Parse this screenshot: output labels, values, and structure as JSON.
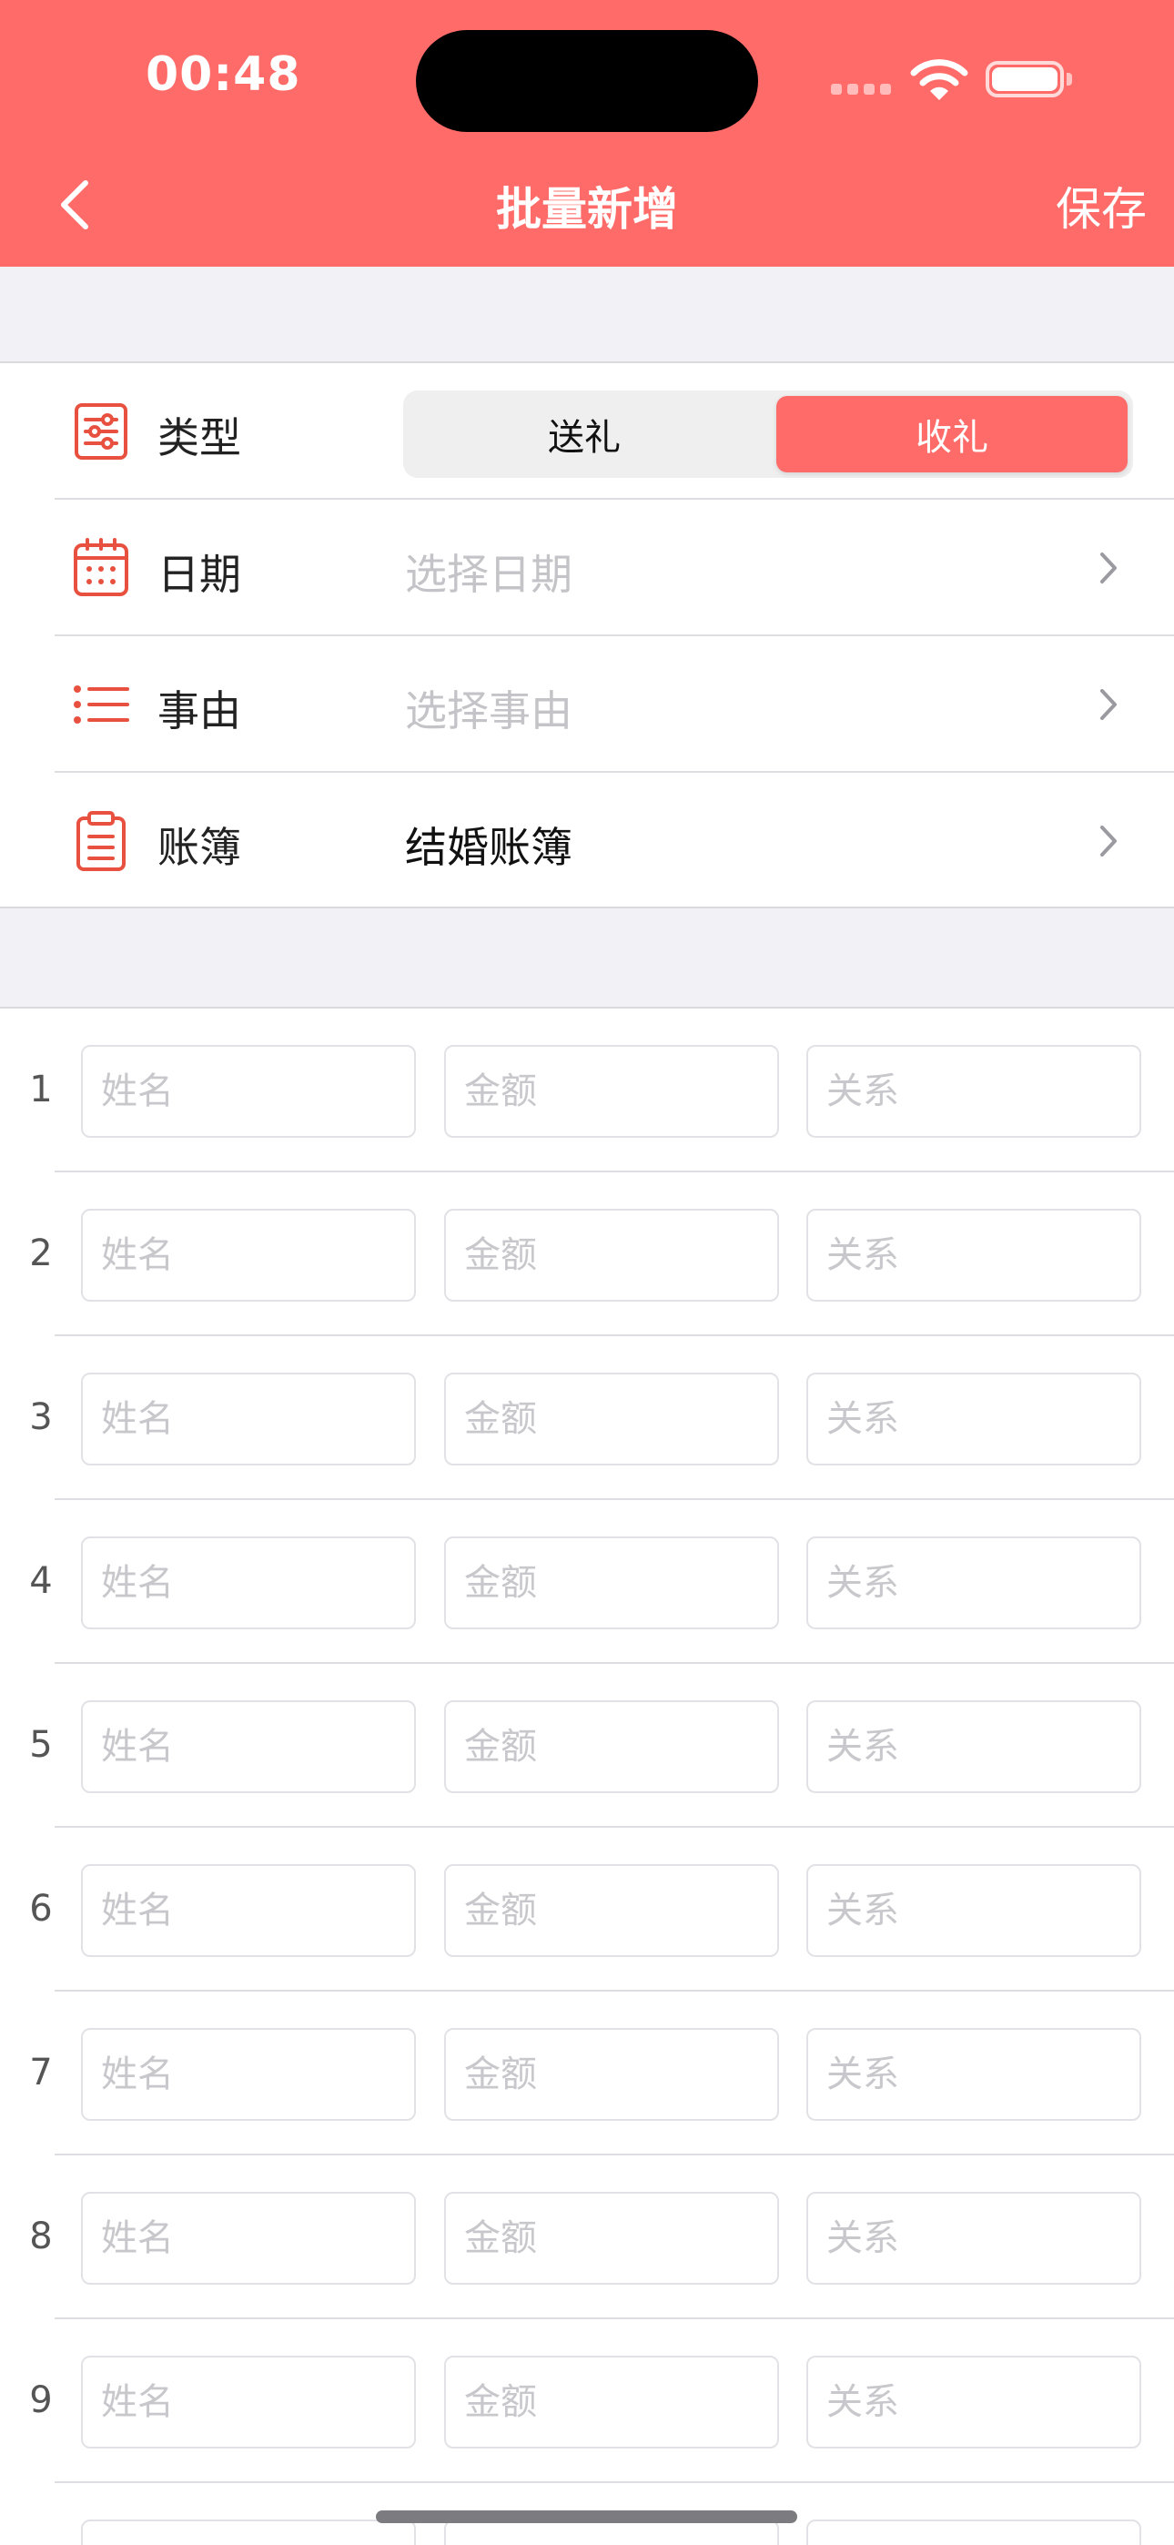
{
  "status_bar": {
    "time": "00:48"
  },
  "nav": {
    "title": "批量新增",
    "save_label": "保存"
  },
  "form": {
    "type": {
      "label": "类型",
      "options": [
        "送礼",
        "收礼"
      ],
      "selected": "收礼"
    },
    "date": {
      "label": "日期",
      "value": "选择日期"
    },
    "reason": {
      "label": "事由",
      "value": "选择事由"
    },
    "ledger": {
      "label": "账簿",
      "value": "结婚账簿"
    }
  },
  "entries": {
    "placeholders": {
      "name": "姓名",
      "amount": "金额",
      "relation": "关系"
    },
    "row_numbers": [
      "1",
      "2",
      "3",
      "4",
      "5",
      "6",
      "7",
      "8",
      "9"
    ]
  },
  "colors": {
    "accent": "#ff6b68",
    "icon_red": "#e8513f"
  }
}
